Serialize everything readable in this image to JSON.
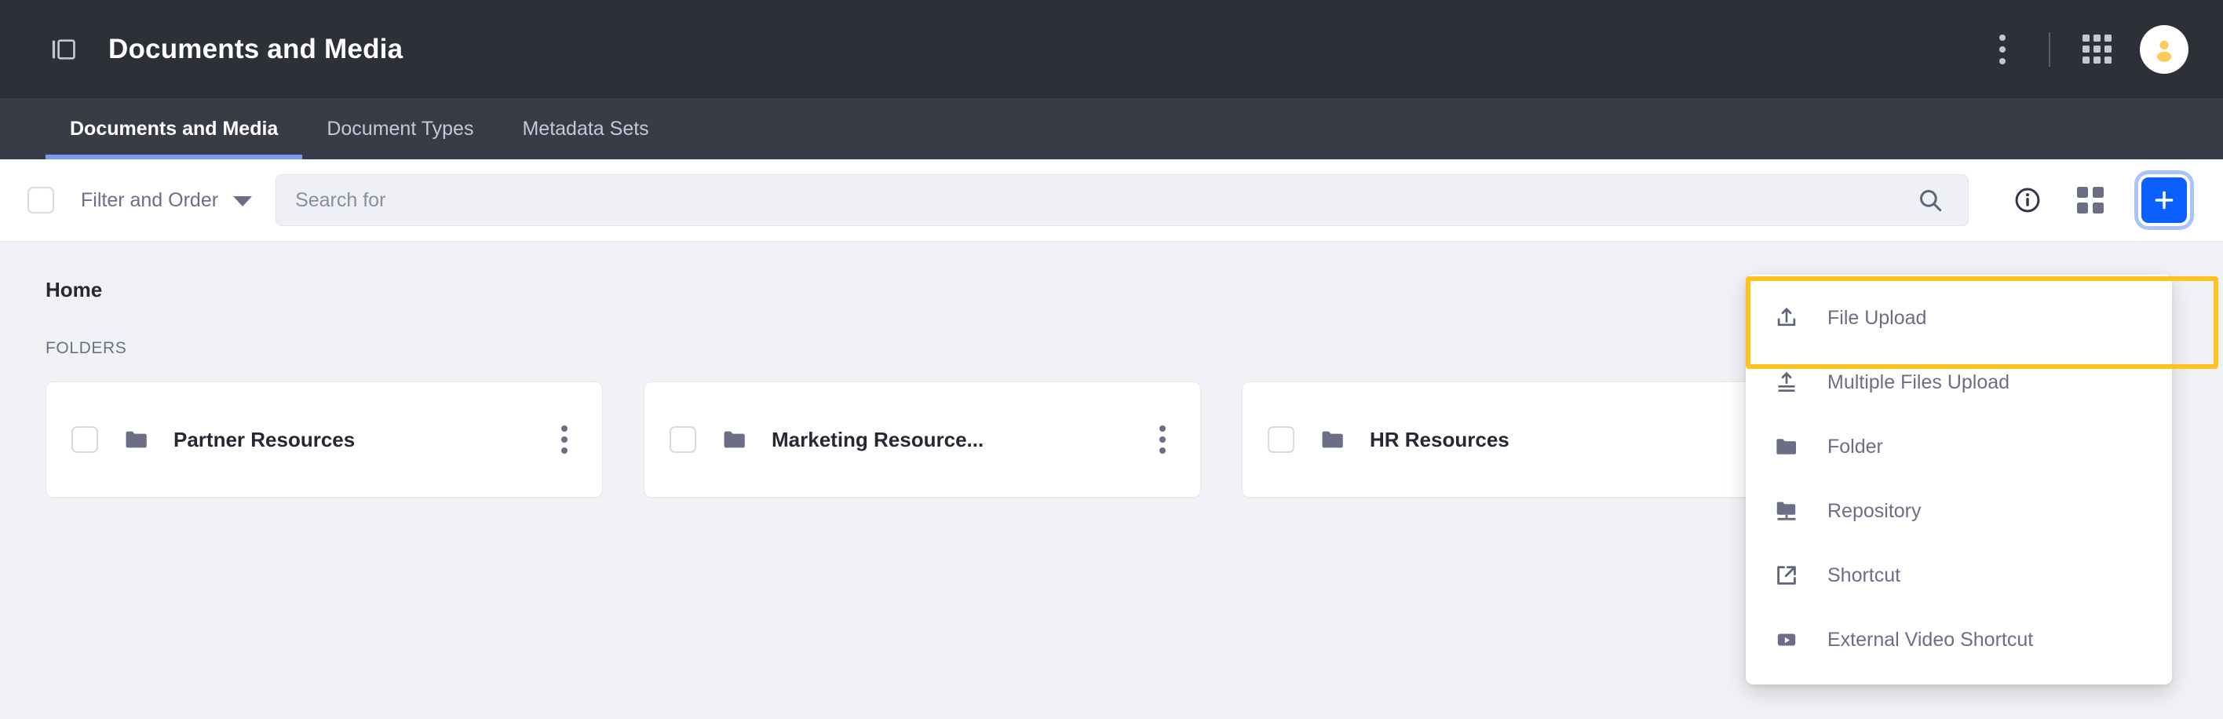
{
  "header": {
    "title": "Documents and Media",
    "sidebar_toggle_icon": "panel-toggle-icon",
    "kebab_icon": "more-options-icon",
    "apps_icon": "applications-grid-icon",
    "avatar_icon": "user-avatar-icon"
  },
  "tabs": [
    {
      "label": "Documents and Media",
      "active": true
    },
    {
      "label": "Document Types",
      "active": false
    },
    {
      "label": "Metadata Sets",
      "active": false
    }
  ],
  "toolbar": {
    "select_all_checkbox": "unchecked",
    "filter_label": "Filter and Order",
    "search": {
      "placeholder": "Search for",
      "value": ""
    },
    "info_icon": "info-circle-icon",
    "view_icon": "grid-view-icon",
    "add_button_label": "+",
    "accent_color": "#0b5fff",
    "focus_ring_color": "#a8c4fb"
  },
  "content": {
    "breadcrumb": "Home",
    "section_label": "FOLDERS",
    "folders": [
      {
        "name": "Partner Resources"
      },
      {
        "name": "Marketing Resource..."
      },
      {
        "name": "HR Resources"
      }
    ]
  },
  "dropdown": {
    "items": [
      {
        "label": "File Upload",
        "icon": "file-upload-icon",
        "highlighted": true
      },
      {
        "label": "Multiple Files Upload",
        "icon": "multiple-files-upload-icon",
        "highlighted": true
      },
      {
        "label": "Folder",
        "icon": "folder-icon",
        "highlighted": false
      },
      {
        "label": "Repository",
        "icon": "repository-icon",
        "highlighted": false
      },
      {
        "label": "Shortcut",
        "icon": "shortcut-icon",
        "highlighted": false
      },
      {
        "label": "External Video Shortcut",
        "icon": "external-video-icon",
        "highlighted": false
      }
    ],
    "highlight_color": "#ffc220"
  }
}
